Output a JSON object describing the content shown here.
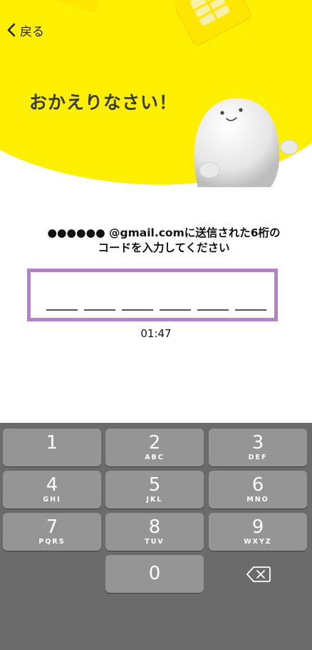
{
  "header": {
    "back_label": "戻る",
    "title": "おかえりなさい！"
  },
  "instruction": {
    "line1": "●●●●●● @gmail.comに送信された6桁の",
    "line2": "コードを入力してください"
  },
  "code": {
    "length": 6,
    "value": ""
  },
  "timer": "01:47",
  "keypad": {
    "keys": [
      {
        "digit": "1",
        "letters": ""
      },
      {
        "digit": "2",
        "letters": "ABC"
      },
      {
        "digit": "3",
        "letters": "DEF"
      },
      {
        "digit": "4",
        "letters": "GHI"
      },
      {
        "digit": "5",
        "letters": "JKL"
      },
      {
        "digit": "6",
        "letters": "MNO"
      },
      {
        "digit": "7",
        "letters": "PQRS"
      },
      {
        "digit": "8",
        "letters": "TUV"
      },
      {
        "digit": "9",
        "letters": "WXYZ"
      },
      {
        "digit": "0",
        "letters": ""
      }
    ],
    "backspace_icon": "backspace-icon"
  },
  "colors": {
    "hero_yellow": "#ffef00",
    "code_border": "#b482c8",
    "keypad_bg": "#6b6b6b",
    "key_bg": "#959595"
  },
  "icons": {
    "back": "chevron-left-icon",
    "sim": "sim-card-illustration",
    "mascot": "mascot-illustration"
  }
}
